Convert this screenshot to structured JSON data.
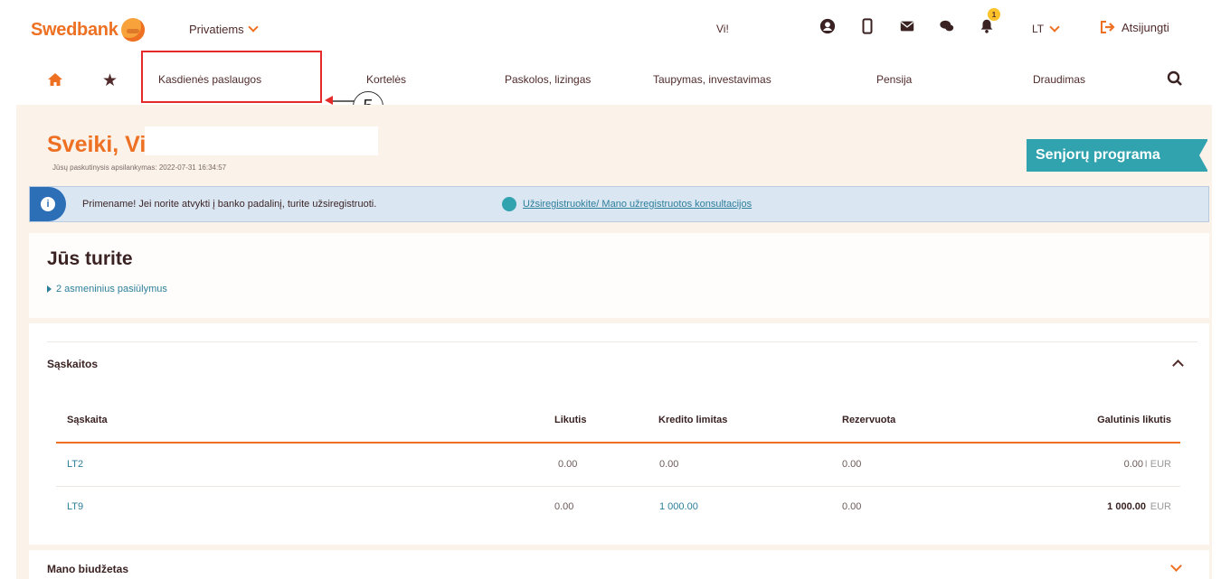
{
  "header": {
    "brand": "Swedbank",
    "segment": "Privatiems",
    "user_short": "Vi!",
    "notification_count": "1",
    "language": "LT",
    "logout": "Atsijungti",
    "icons": [
      "user-icon",
      "mobile-icon",
      "mail-icon",
      "chat-icon",
      "bell-icon"
    ]
  },
  "nav": {
    "items": [
      "Kasdienės paslaugos",
      "Kortelės",
      "Paskolos, lizingas",
      "Taupymas, investavimas",
      "Pensija",
      "Draudimas"
    ]
  },
  "annotation": {
    "step": "5"
  },
  "greeting": {
    "title": "Sveiki, Vi",
    "last_login": "Jūsų paskutinysis apsilankymas: 2022-07-31 16:34:57",
    "senior_banner": "Senjorų programa"
  },
  "info": {
    "text": "Primename! Jei norite atvykti į banko padalinį, turite užsiregistruoti.",
    "link": "Užsiregistruokite/ Mano užregistruotos konsultacijos"
  },
  "offers": {
    "title": "Jūs turite",
    "link": "2 asmeninius pasiūlymus"
  },
  "accounts": {
    "title": "Sąskaitos",
    "columns": [
      "Sąskaita",
      "Likutis",
      "Kredito limitas",
      "Rezervuota",
      "Galutinis likutis"
    ],
    "rows": [
      {
        "account": "LT2",
        "balance": "0.00",
        "credit_limit": "0.00",
        "reserved": "0.00",
        "final": "0.00",
        "currency": "I EUR"
      },
      {
        "account": "LT9",
        "balance": "0.00",
        "credit_limit": "1 000.00",
        "reserved": "0.00",
        "final": "1 000.00",
        "currency": "EUR"
      }
    ]
  },
  "budget": {
    "title": "Mano biudžetas"
  },
  "colors": {
    "brand_orange": "#ee7023",
    "teal": "#31a3ae",
    "highlight_red": "#e52a2a",
    "cream": "#fbf2ea"
  }
}
